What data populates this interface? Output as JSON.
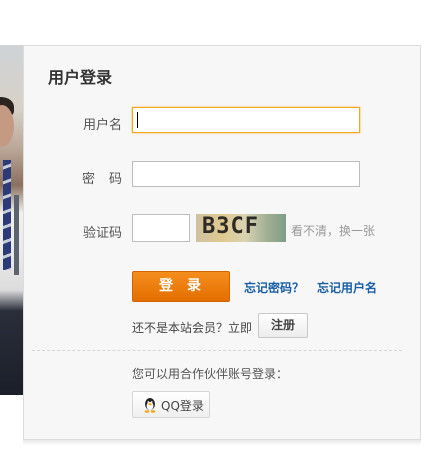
{
  "panel": {
    "title": "用户登录"
  },
  "form": {
    "username_label": "用户名",
    "username_value": "",
    "password_label": "密码",
    "password_value": "",
    "captcha_label": "验证码",
    "captcha_value": "",
    "captcha_image_text": "B3CF",
    "captcha_refresh": "看不清，换一张"
  },
  "actions": {
    "login_label": "登录",
    "forgot_password": "忘记密码？",
    "forgot_username": "忘记用户名",
    "not_member_text": "还不是本站会员？立即",
    "register_label": "注册"
  },
  "partner": {
    "prompt": "您可以用合作伙伴账号登录：",
    "qq_label": "QQ登录"
  },
  "colors": {
    "accent_orange": "#f07f0f",
    "link_blue": "#1a5fa8",
    "focus_border": "#f0a81e"
  },
  "icons": {
    "qq": "qq-penguin-icon"
  }
}
